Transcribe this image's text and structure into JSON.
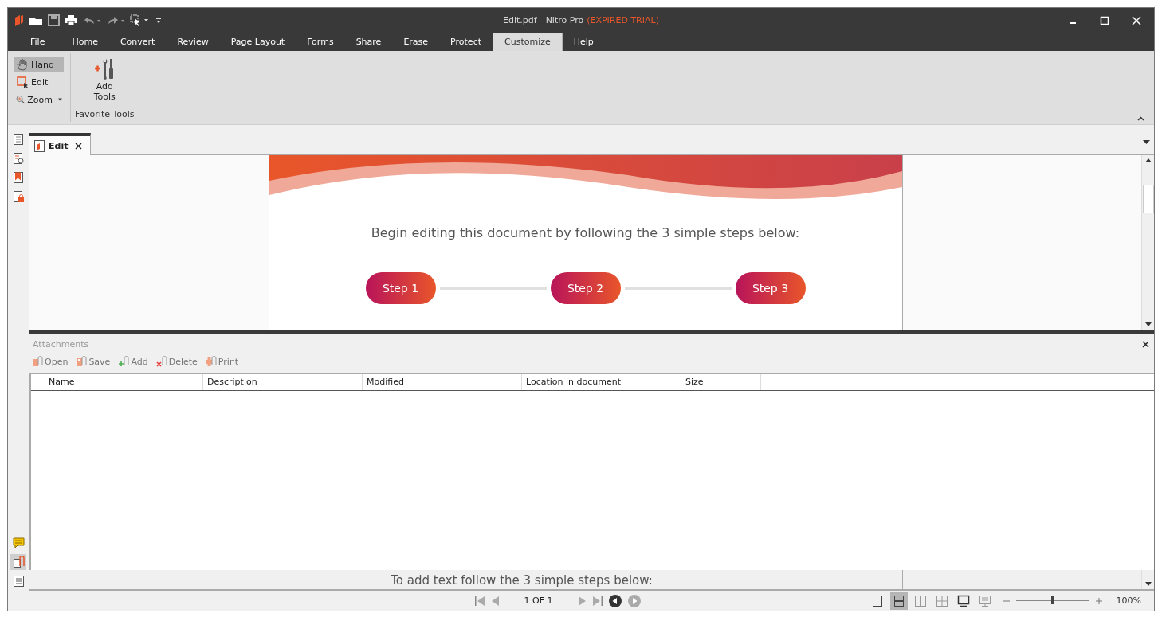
{
  "window": {
    "title": "Edit.pdf - Nitro Pro",
    "trial_badge": "(EXPIRED TRIAL)"
  },
  "menu_tabs": [
    {
      "label": "File",
      "kind": "file",
      "selected": false
    },
    {
      "label": "Home",
      "kind": "tab",
      "selected": false
    },
    {
      "label": "Convert",
      "kind": "tab",
      "selected": false
    },
    {
      "label": "Review",
      "kind": "tab",
      "selected": false
    },
    {
      "label": "Page Layout",
      "kind": "tab",
      "selected": false
    },
    {
      "label": "Forms",
      "kind": "tab",
      "selected": false
    },
    {
      "label": "Share",
      "kind": "tab",
      "selected": false
    },
    {
      "label": "Erase",
      "kind": "tab",
      "selected": false
    },
    {
      "label": "Protect",
      "kind": "tab",
      "selected": false
    },
    {
      "label": "Customize",
      "kind": "tab",
      "selected": true
    },
    {
      "label": "Help",
      "kind": "tab",
      "selected": false
    }
  ],
  "ribbon": {
    "tools": [
      {
        "label": "Hand",
        "kind": "hand",
        "selected": true
      },
      {
        "label": "Edit",
        "kind": "edit",
        "selected": false
      },
      {
        "label": "Zoom",
        "kind": "zoom",
        "selected": false
      }
    ],
    "group": {
      "button": "Add Tools",
      "label": "Favorite Tools"
    }
  },
  "side_icons_top": [
    {
      "kind": "pages",
      "selected": false
    },
    {
      "kind": "search",
      "selected": false
    },
    {
      "kind": "bookmarks",
      "selected": false
    },
    {
      "kind": "security",
      "selected": false
    }
  ],
  "side_icons_bottom": [
    {
      "kind": "comments",
      "selected": false
    },
    {
      "kind": "attachments",
      "selected": true
    },
    {
      "kind": "list",
      "selected": false
    }
  ],
  "document_tab": {
    "label": "Edit",
    "selected": true
  },
  "page": {
    "heading": "Begin editing this document by following the 3 simple steps below:",
    "steps": [
      "Step 1",
      "Step 2",
      "Step 3"
    ]
  },
  "next_page_text": "To add text follow the 3 simple steps below:",
  "attachments": {
    "title": "Attachments",
    "toolbar": [
      {
        "label": "Open",
        "kind": "open"
      },
      {
        "label": "Save",
        "kind": "save"
      },
      {
        "label": "Add",
        "kind": "add"
      },
      {
        "label": "Delete",
        "kind": "delete"
      },
      {
        "label": "Print",
        "kind": "print"
      }
    ],
    "columns": [
      "Name",
      "Description",
      "Modified",
      "Location in document",
      "Size"
    ]
  },
  "status_bar": {
    "page_indicator": "1 OF 1",
    "view_modes": [
      {
        "kind": "single",
        "selected": false
      },
      {
        "kind": "continuous",
        "selected": true
      },
      {
        "kind": "facing",
        "selected": false
      },
      {
        "kind": "facing-continuous",
        "selected": false
      },
      {
        "kind": "full-screen",
        "selected": false
      },
      {
        "kind": "presentation",
        "selected": false
      }
    ],
    "zoom": {
      "level": 0.5,
      "reading": "100%"
    }
  }
}
